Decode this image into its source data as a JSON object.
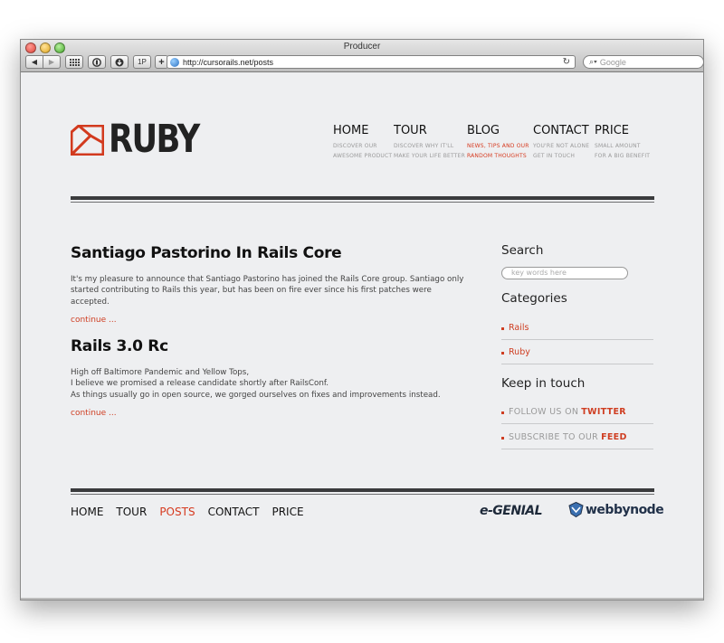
{
  "window": {
    "title": "Producer",
    "url": "http://cursorails.net/posts",
    "search_placeholder": "Google",
    "buttons": {
      "bookmarks": "",
      "onepassword": "1P",
      "add": "+"
    }
  },
  "site": {
    "logo_text": "RUBY",
    "nav": [
      {
        "title": "HOME",
        "sub1": "DISCOVER OUR",
        "sub2": "AWESOME PRODUCT"
      },
      {
        "title": "TOUR",
        "sub1": "DISCOVER WHY IT'LL",
        "sub2": "MAKE YOUR LIFE BETTER"
      },
      {
        "title": "BLOG",
        "sub1": "NEWS, TIPS AND OUR",
        "sub2": "RANDOM THOUGHTS"
      },
      {
        "title": "CONTACT",
        "sub1": "YOU'RE NOT ALONE",
        "sub2": "GET IN TOUCH"
      },
      {
        "title": "PRICE",
        "sub1": "SMALL AMOUNT",
        "sub2": "FOR A BIG BENEFIT"
      }
    ],
    "active_nav": "BLOG"
  },
  "posts": [
    {
      "title": "Santiago Pastorino In Rails Core",
      "body": [
        "It's my pleasure to announce that Santiago Pastorino has joined the Rails Core group. Santiago only started contributing to Rails this year, but has been on fire ever since his first patches were accepted."
      ],
      "more": "continue ..."
    },
    {
      "title": "Rails 3.0 Rc",
      "body": [
        "High off Baltimore Pandemic and Yellow Tops,",
        "I believe we promised a release candidate shortly after RailsConf.",
        "As things usually go in open source, we gorged ourselves on fixes and improvements instead."
      ],
      "more": "continue ..."
    }
  ],
  "sidebar": {
    "search_heading": "Search",
    "search_placeholder": "key words here",
    "categories_heading": "Categories",
    "categories": [
      "Rails",
      "Ruby"
    ],
    "keep_heading": "Keep in touch",
    "keep": [
      {
        "prefix": "FOLLOW US ON",
        "highlight": "TWITTER"
      },
      {
        "prefix": "SUBSCRIBE TO OUR",
        "highlight": "FEED"
      }
    ]
  },
  "footer": {
    "nav": [
      "HOME",
      "TOUR",
      "POSTS",
      "CONTACT",
      "PRICE"
    ],
    "active": "POSTS",
    "sponsor1": "e-GENIAL",
    "sponsor2": "webbynode"
  },
  "colors": {
    "accent": "#cf3e22",
    "dark": "#3a3b3d"
  }
}
